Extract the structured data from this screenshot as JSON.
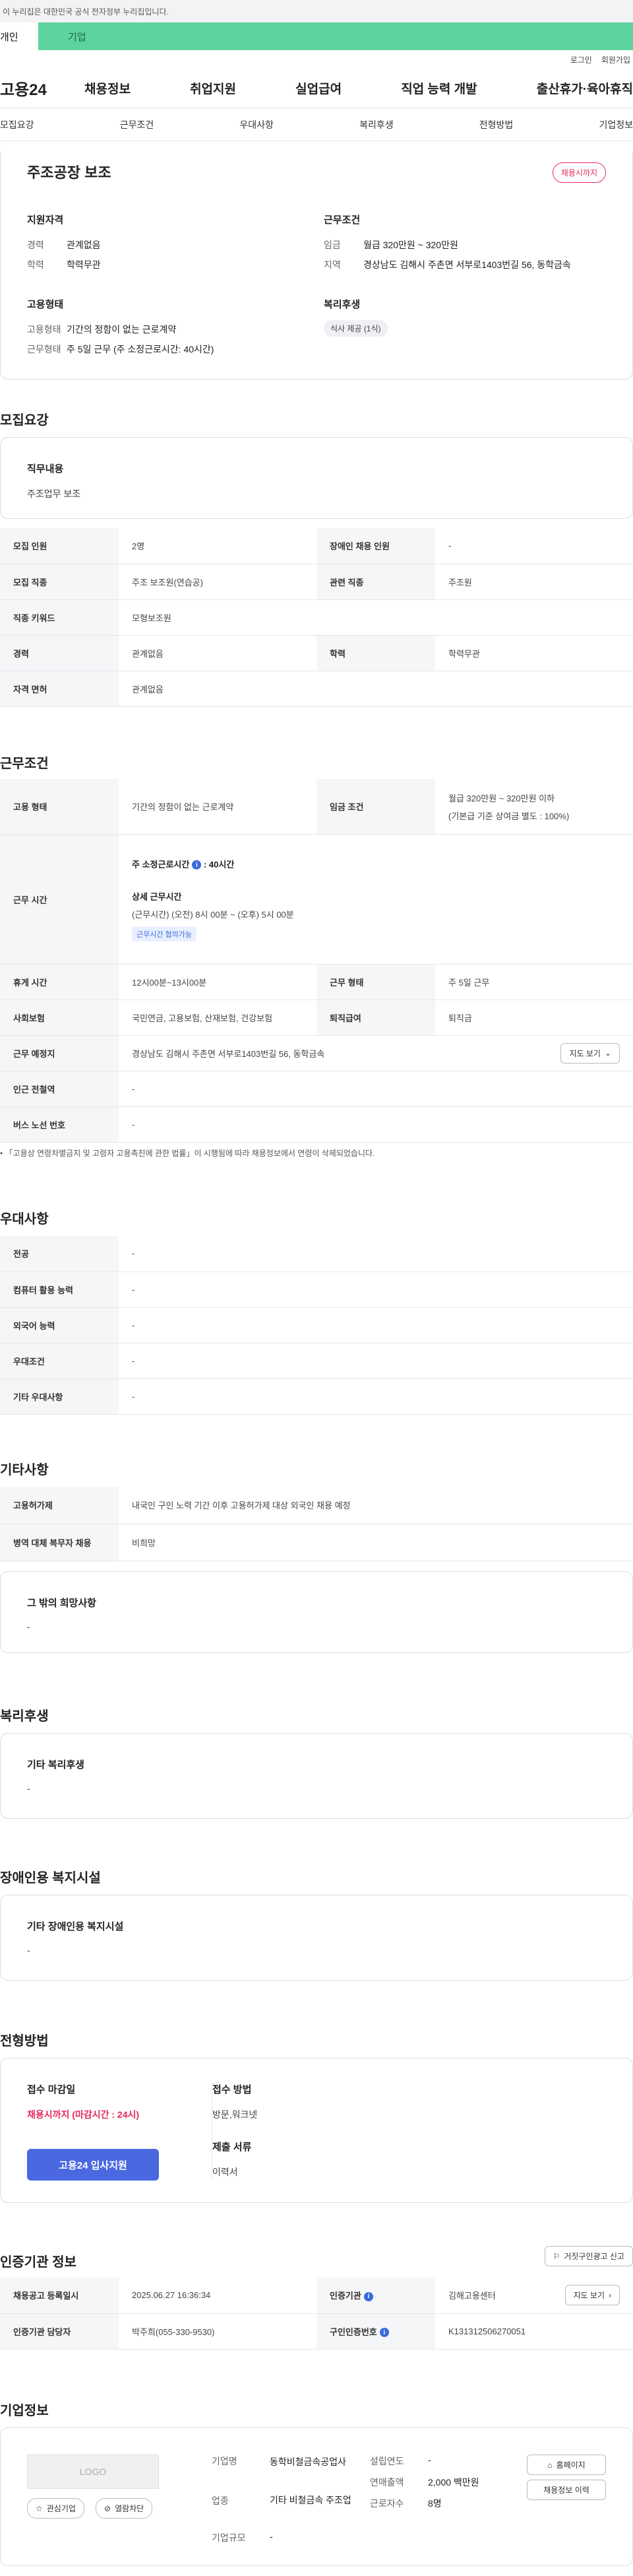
{
  "gov_notice": "이 누리집은 대한민국 공식 전자정부 누리집입니다.",
  "user_tabs": {
    "personal": "개인",
    "corporate": "기업"
  },
  "util": {
    "login": "로그인",
    "signup": "회원가입"
  },
  "gnb": {
    "logo": "고용24",
    "menu": [
      "채용정보",
      "취업지원",
      "실업급여",
      "직업 능력 개발",
      "출산휴가·육아휴직"
    ]
  },
  "anchors": [
    "모집요강",
    "근무조건",
    "우대사항",
    "복리후생",
    "전형방법",
    "기업정보"
  ],
  "summary": {
    "title": "주조공장 보조",
    "badge": "채용시까지",
    "qual_head": "지원자격",
    "qual": [
      {
        "k": "경력",
        "v": "관계없음"
      },
      {
        "k": "학력",
        "v": "학력무관"
      }
    ],
    "cond_head": "근무조건",
    "cond": [
      {
        "k": "임금",
        "v": "월급 320만원 ~ 320만원"
      },
      {
        "k": "지역",
        "v": "경상남도 김해시 주촌면 서부로1403번길 56, 동학금속"
      }
    ],
    "emp_head": "고용형태",
    "emp": [
      {
        "k": "고용형태",
        "v": "기간의 정함이 없는 근로계약"
      },
      {
        "k": "근무형태",
        "v": "주 5일 근무 (주 소정근로시간: 40시간)"
      }
    ],
    "welfare_head": "복리후생",
    "welfare_tag": "식사 제공 (1식)"
  },
  "recruit": {
    "heading": "모집요강",
    "job_title": "직무내용",
    "job_value": "주조업무 보조",
    "rows": [
      [
        "모집 인원",
        "2명",
        "장애인 채용 인원",
        "-"
      ],
      [
        "모집 직종",
        "주조 보조원(연습공)",
        "관련 직종",
        "주조원"
      ],
      [
        "직종 키워드",
        "모형보조원",
        "",
        ""
      ],
      [
        "경력",
        "관계없음",
        "학력",
        "학력무관"
      ],
      [
        "자격 면허",
        "관계없음",
        "",
        ""
      ]
    ]
  },
  "work": {
    "heading": "근무조건",
    "type_label": "고용 형태",
    "type_value": "기간의 정함이 없는 근로계약",
    "wage_label": "임금 조건",
    "wage_value": "월급 320만원 ~ 320만원 이하",
    "wage_sub": "(기본급 기준 상여금 별도 : 100%)",
    "hours_label": "근무 시간",
    "weekly_hours_label": "주 소정근로시간",
    "weekly_hours_value": ": 40시간",
    "detail_label": "상세 근무시간",
    "detail_value": "(근무시간) (오전) 8시 00분 ~ (오후) 5시 00분",
    "flex_tag": "근무시간 협의가능",
    "rows": [
      [
        "휴게 시간",
        "12시00분~13시00분",
        "근무 형태",
        "주 5일 근무"
      ],
      [
        "사회보험",
        "국민연금, 고용보험, 산재보험, 건강보험",
        "퇴직급여",
        "퇴직금"
      ]
    ],
    "place_label": "근무 예정지",
    "place_value": "경상남도 김해시 주촌면 서부로1403번길 56, 동학금속",
    "map_btn": "지도 보기",
    "subway_label": "인근 전철역",
    "subway_value": "-",
    "bus_label": "버스 노선 번호",
    "bus_value": "-",
    "notice": "「고용상 연령차별금지 및 고령자 고용촉진에 관한 법률」이 시행됨에 따라 채용정보에서 연령이 삭제되었습니다."
  },
  "prefer": {
    "heading": "우대사항",
    "rows": [
      [
        "전공",
        "-"
      ],
      [
        "컴퓨터 활용 능력",
        "-"
      ],
      [
        "외국어 능력",
        "-"
      ],
      [
        "우대조건",
        "-"
      ],
      [
        "기타 우대사항",
        "-"
      ]
    ]
  },
  "etc": {
    "heading": "기타사항",
    "rows": [
      [
        "고용허가제",
        "내국인 구인 노력 기간 이후 고용허가제 대상 외국인 채용 예정"
      ],
      [
        "병역 대체 복무자 채용",
        "비희망"
      ]
    ],
    "other_title": "그 밖의 희망사항",
    "other_value": "-"
  },
  "welfare": {
    "heading": "복리후생",
    "title": "기타 복리후생",
    "value": "-"
  },
  "disabled": {
    "heading": "장애인용 복지시설",
    "title": "기타 장애인용 복지시설",
    "value": "-"
  },
  "selection": {
    "heading": "전형방법",
    "deadline_label": "접수 마감일",
    "deadline_value": "채용시까지 (마감시간 : 24시)",
    "apply_btn": "고용24 입사지원",
    "method_label": "접수 방법",
    "method_value": "방문,워크넷",
    "docs_label": "제출 서류",
    "docs_value": "이력서"
  },
  "auth": {
    "heading": "인증기관 정보",
    "report_btn": "거짓구인광고 신고",
    "reg_label": "채용공고 등록일시",
    "reg_value": "2025.06.27 16:36:34",
    "org_label": "인증기관",
    "org_value": "김해고용센터",
    "map_btn": "지도 보기",
    "mgr_label": "인증기관 담당자",
    "mgr_value": "박주희(055-330-9530)",
    "num_label": "구인인증번호",
    "num_value": "K131312506270051"
  },
  "company": {
    "heading": "기업정보",
    "logo": "LOGO",
    "fav_btn": "관심기업",
    "block_btn": "열람차단",
    "name_label": "기업명",
    "name_value": "동학비철금속공업사",
    "industry_label": "업종",
    "industry_value": "기타 비철금속 주조업",
    "size_label": "기업규모",
    "size_value": "-",
    "founded_label": "설립연도",
    "founded_value": "-",
    "sales_label": "연매출액",
    "sales_value": "2,000 백만원",
    "workers_label": "근로자수",
    "workers_value": "8명",
    "home_btn": "홈페이지",
    "history_btn": "채용정보 이력"
  },
  "colors": {
    "accent_green": "#5dd39e",
    "primary_blue": "#4a68e0",
    "deadline_red": "#e6285b"
  }
}
